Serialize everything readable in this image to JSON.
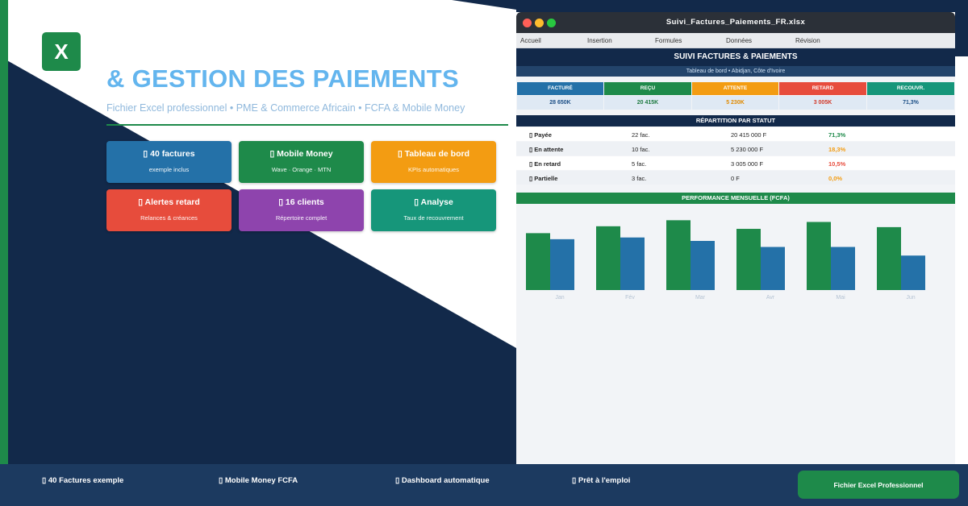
{
  "colors": {
    "green": "#1e8a4a",
    "navy": "#12294a",
    "blue": "#2471a8",
    "orange": "#f39c12",
    "red": "#e74c3c",
    "purple": "#8e44ad",
    "teal": "#16967a"
  },
  "logo": {
    "letter": "X"
  },
  "hero": {
    "title": "& GESTION DES PAIEMENTS",
    "subtitle": "Fichier Excel professionnel • PME & Commerce Africain • FCFA & Mobile Money"
  },
  "cards": [
    {
      "title": "▯ 40 factures",
      "sub": "exemple inclus",
      "color": "#2471a8",
      "icon": "box-glyph-icon"
    },
    {
      "title": "▯ Mobile Money",
      "sub": "Wave · Orange · MTN",
      "color": "#1e8a4a",
      "icon": "box-glyph-icon"
    },
    {
      "title": "▯ Tableau de bord",
      "sub": "KPIs automatiques",
      "color": "#f39c12",
      "icon": "box-glyph-icon"
    },
    {
      "title": "▯ Alertes retard",
      "sub": "Relances & créances",
      "color": "#e74c3c",
      "icon": "box-glyph-icon"
    },
    {
      "title": "▯ 16 clients",
      "sub": "Répertoire complet",
      "color": "#8e44ad",
      "icon": "box-glyph-icon"
    },
    {
      "title": "▯ Analyse",
      "sub": "Taux de recouvrement",
      "color": "#16967a",
      "icon": "box-glyph-icon"
    }
  ],
  "window": {
    "title": "Suivi_Factures_Paiements_FR.xlsx",
    "menu": [
      "Accueil",
      "Insertion",
      "Formules",
      "Données",
      "Révision"
    ],
    "sheet_title": "SUIVI FACTURES & PAIEMENTS",
    "sheet_subtitle": "Tableau de bord • Abidjan, Côte d'Ivoire",
    "kpis": [
      {
        "label": "FACTURÉ",
        "value": "28 650K",
        "color": "#2471a8",
        "value_color": "#1c4f86"
      },
      {
        "label": "REÇU",
        "value": "20 415K",
        "color": "#1e8a4a",
        "value_color": "#1e7a40"
      },
      {
        "label": "ATTENTE",
        "value": "5 230K",
        "color": "#f39c12",
        "value_color": "#e08a00"
      },
      {
        "label": "RETARD",
        "value": "3 005K",
        "color": "#e74c3c",
        "value_color": "#d23a2a"
      },
      {
        "label": "RECOUVR.",
        "value": "71,3%",
        "color": "#16967a",
        "value_color": "#1c4f86"
      }
    ],
    "status_header": "RÉPARTITION PAR STATUT",
    "status_rows": [
      {
        "label": "▯ Payée",
        "count": "22 fac.",
        "amount": "20 415 000 F",
        "pct": "71,3%",
        "pct_color": "#1e8a4a"
      },
      {
        "label": "▯ En attente",
        "count": "10 fac.",
        "amount": "5 230 000 F",
        "pct": "18,3%",
        "pct_color": "#f39c12"
      },
      {
        "label": "▯ En retard",
        "count": "5 fac.",
        "amount": "3 005 000 F",
        "pct": "10,5%",
        "pct_color": "#e74c3c"
      },
      {
        "label": "▯ Partielle",
        "count": "3 fac.",
        "amount": "0 F",
        "pct": "0,0%",
        "pct_color": "#f39c12"
      }
    ],
    "perf_header": "PERFORMANCE MENSUELLE (FCFA)"
  },
  "chart_data": {
    "type": "bar",
    "categories": [
      "Jan",
      "Fév",
      "Mar",
      "Avr",
      "Mai",
      "Jun"
    ],
    "series": [
      {
        "values": [
          66,
          74,
          81,
          71,
          79,
          73
        ],
        "color": "#1e8a4a"
      },
      {
        "values": [
          59,
          61,
          57,
          50,
          50,
          40
        ],
        "color": "#2471a8"
      }
    ],
    "ylim": [
      0,
      100
    ],
    "grid": false,
    "legend": "none"
  },
  "footer": {
    "features": [
      "▯ 40 Factures exemple",
      "▯ Mobile Money FCFA",
      "▯ Dashboard automatique",
      "▯ Prêt à l'emploi"
    ],
    "cta": "Fichier Excel Professionnel"
  }
}
